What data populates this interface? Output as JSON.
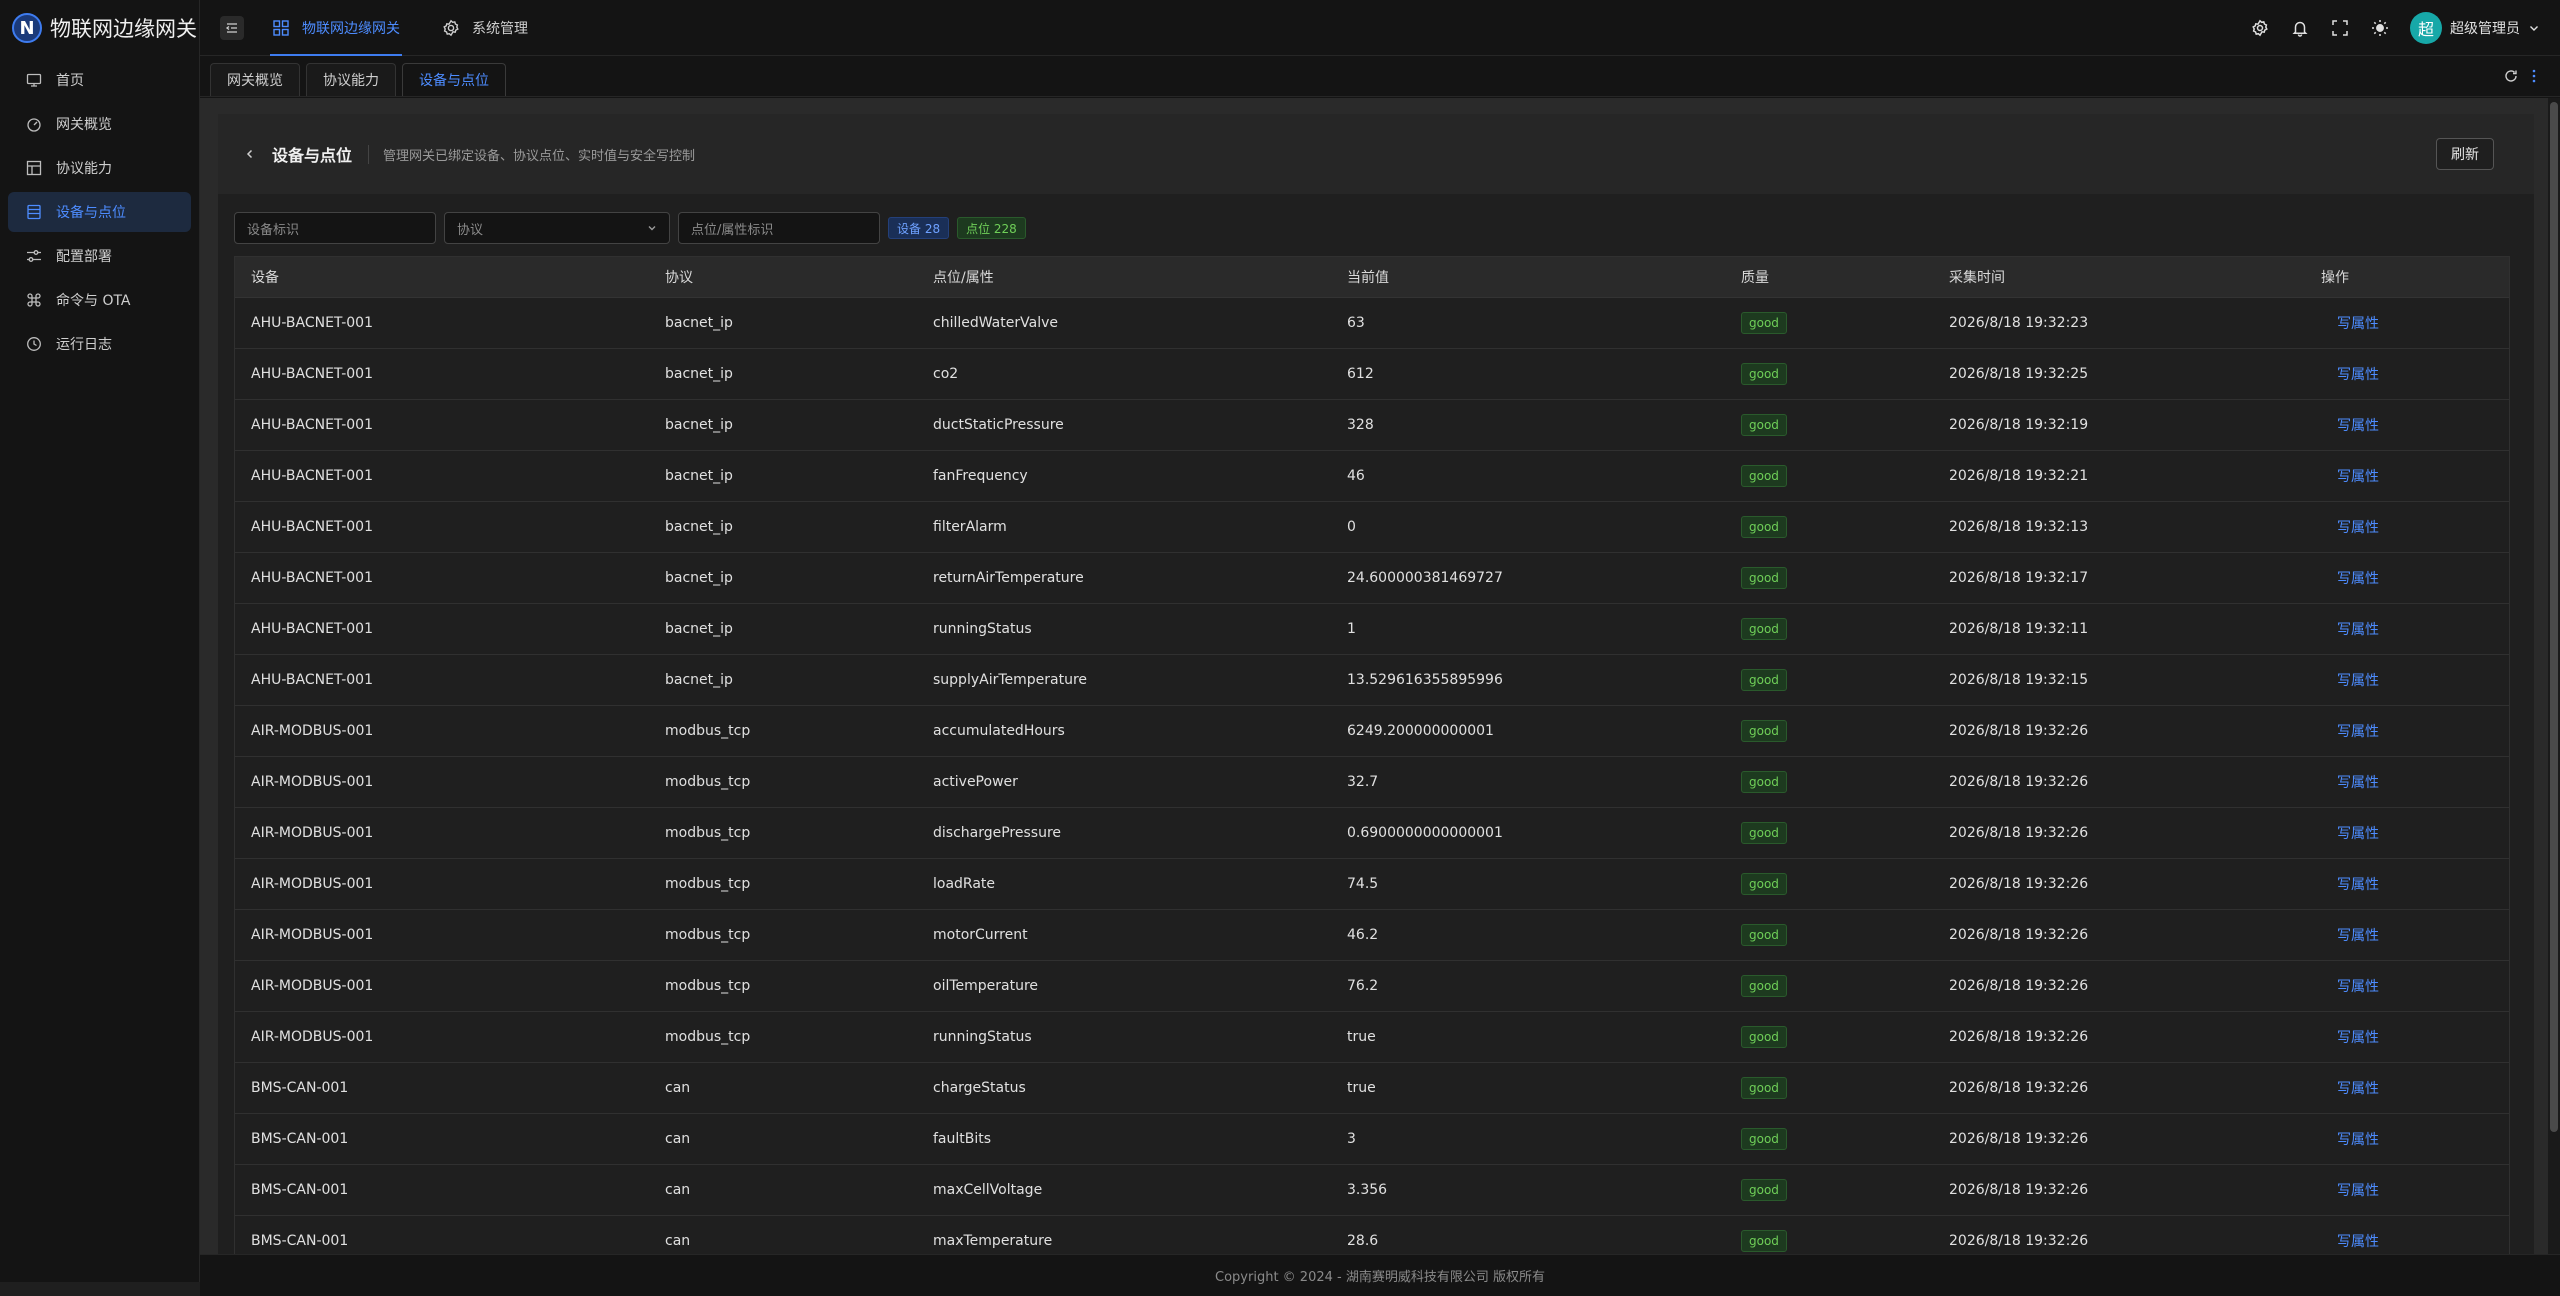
{
  "app": {
    "logo_char": "N",
    "title": "物联网边缘网关"
  },
  "sidebar": {
    "items": [
      {
        "label": "首页",
        "icon": "monitor-icon",
        "active": false
      },
      {
        "label": "网关概览",
        "icon": "dashboard-icon",
        "active": false
      },
      {
        "label": "协议能力",
        "icon": "layout-icon",
        "active": false
      },
      {
        "label": "设备与点位",
        "icon": "list-icon",
        "active": true
      },
      {
        "label": "配置部署",
        "icon": "sliders-icon",
        "active": false
      },
      {
        "label": "命令与 OTA",
        "icon": "command-icon",
        "active": false
      },
      {
        "label": "运行日志",
        "icon": "history-icon",
        "active": false
      }
    ]
  },
  "topbar": {
    "nav": [
      {
        "label": "物联网边缘网关",
        "active": true
      },
      {
        "label": "系统管理",
        "active": false
      }
    ],
    "user": {
      "avatar_char": "超",
      "name": "超级管理员"
    }
  },
  "tabs": [
    {
      "label": "网关概览",
      "active": false
    },
    {
      "label": "协议能力",
      "active": false
    },
    {
      "label": "设备与点位",
      "active": true
    }
  ],
  "page": {
    "title": "设备与点位",
    "subtitle": "管理网关已绑定设备、协议点位、实时值与安全写控制",
    "refresh_label": "刷新"
  },
  "filters": {
    "device_placeholder": "设备标识",
    "protocol_placeholder": "协议",
    "point_placeholder": "点位/属性标识",
    "device_count_tag": "设备 28",
    "point_count_tag": "点位 228"
  },
  "table": {
    "columns": [
      "设备",
      "协议",
      "点位/属性",
      "当前值",
      "质量",
      "采集时间",
      "操作"
    ],
    "rows": [
      {
        "device": "AHU-BACNET-001",
        "protocol": "bacnet_ip",
        "point": "chilledWaterValve",
        "value": "63",
        "quality": "good",
        "time": "2026/8/18 19:32:23",
        "action": "写属性"
      },
      {
        "device": "AHU-BACNET-001",
        "protocol": "bacnet_ip",
        "point": "co2",
        "value": "612",
        "quality": "good",
        "time": "2026/8/18 19:32:25",
        "action": "写属性"
      },
      {
        "device": "AHU-BACNET-001",
        "protocol": "bacnet_ip",
        "point": "ductStaticPressure",
        "value": "328",
        "quality": "good",
        "time": "2026/8/18 19:32:19",
        "action": "写属性"
      },
      {
        "device": "AHU-BACNET-001",
        "protocol": "bacnet_ip",
        "point": "fanFrequency",
        "value": "46",
        "quality": "good",
        "time": "2026/8/18 19:32:21",
        "action": "写属性"
      },
      {
        "device": "AHU-BACNET-001",
        "protocol": "bacnet_ip",
        "point": "filterAlarm",
        "value": "0",
        "quality": "good",
        "time": "2026/8/18 19:32:13",
        "action": "写属性"
      },
      {
        "device": "AHU-BACNET-001",
        "protocol": "bacnet_ip",
        "point": "returnAirTemperature",
        "value": "24.600000381469727",
        "quality": "good",
        "time": "2026/8/18 19:32:17",
        "action": "写属性"
      },
      {
        "device": "AHU-BACNET-001",
        "protocol": "bacnet_ip",
        "point": "runningStatus",
        "value": "1",
        "quality": "good",
        "time": "2026/8/18 19:32:11",
        "action": "写属性"
      },
      {
        "device": "AHU-BACNET-001",
        "protocol": "bacnet_ip",
        "point": "supplyAirTemperature",
        "value": "13.529616355895996",
        "quality": "good",
        "time": "2026/8/18 19:32:15",
        "action": "写属性"
      },
      {
        "device": "AIR-MODBUS-001",
        "protocol": "modbus_tcp",
        "point": "accumulatedHours",
        "value": "6249.200000000001",
        "quality": "good",
        "time": "2026/8/18 19:32:26",
        "action": "写属性"
      },
      {
        "device": "AIR-MODBUS-001",
        "protocol": "modbus_tcp",
        "point": "activePower",
        "value": "32.7",
        "quality": "good",
        "time": "2026/8/18 19:32:26",
        "action": "写属性"
      },
      {
        "device": "AIR-MODBUS-001",
        "protocol": "modbus_tcp",
        "point": "dischargePressure",
        "value": "0.6900000000000001",
        "quality": "good",
        "time": "2026/8/18 19:32:26",
        "action": "写属性"
      },
      {
        "device": "AIR-MODBUS-001",
        "protocol": "modbus_tcp",
        "point": "loadRate",
        "value": "74.5",
        "quality": "good",
        "time": "2026/8/18 19:32:26",
        "action": "写属性"
      },
      {
        "device": "AIR-MODBUS-001",
        "protocol": "modbus_tcp",
        "point": "motorCurrent",
        "value": "46.2",
        "quality": "good",
        "time": "2026/8/18 19:32:26",
        "action": "写属性"
      },
      {
        "device": "AIR-MODBUS-001",
        "protocol": "modbus_tcp",
        "point": "oilTemperature",
        "value": "76.2",
        "quality": "good",
        "time": "2026/8/18 19:32:26",
        "action": "写属性"
      },
      {
        "device": "AIR-MODBUS-001",
        "protocol": "modbus_tcp",
        "point": "runningStatus",
        "value": "true",
        "quality": "good",
        "time": "2026/8/18 19:32:26",
        "action": "写属性"
      },
      {
        "device": "BMS-CAN-001",
        "protocol": "can",
        "point": "chargeStatus",
        "value": "true",
        "quality": "good",
        "time": "2026/8/18 19:32:26",
        "action": "写属性"
      },
      {
        "device": "BMS-CAN-001",
        "protocol": "can",
        "point": "faultBits",
        "value": "3",
        "quality": "good",
        "time": "2026/8/18 19:32:26",
        "action": "写属性"
      },
      {
        "device": "BMS-CAN-001",
        "protocol": "can",
        "point": "maxCellVoltage",
        "value": "3.356",
        "quality": "good",
        "time": "2026/8/18 19:32:26",
        "action": "写属性"
      },
      {
        "device": "BMS-CAN-001",
        "protocol": "can",
        "point": "maxTemperature",
        "value": "28.6",
        "quality": "good",
        "time": "2026/8/18 19:32:26",
        "action": "写属性"
      }
    ]
  },
  "footer": {
    "copyright": "Copyright © 2024 - 湖南赛明威科技有限公司 版权所有"
  }
}
